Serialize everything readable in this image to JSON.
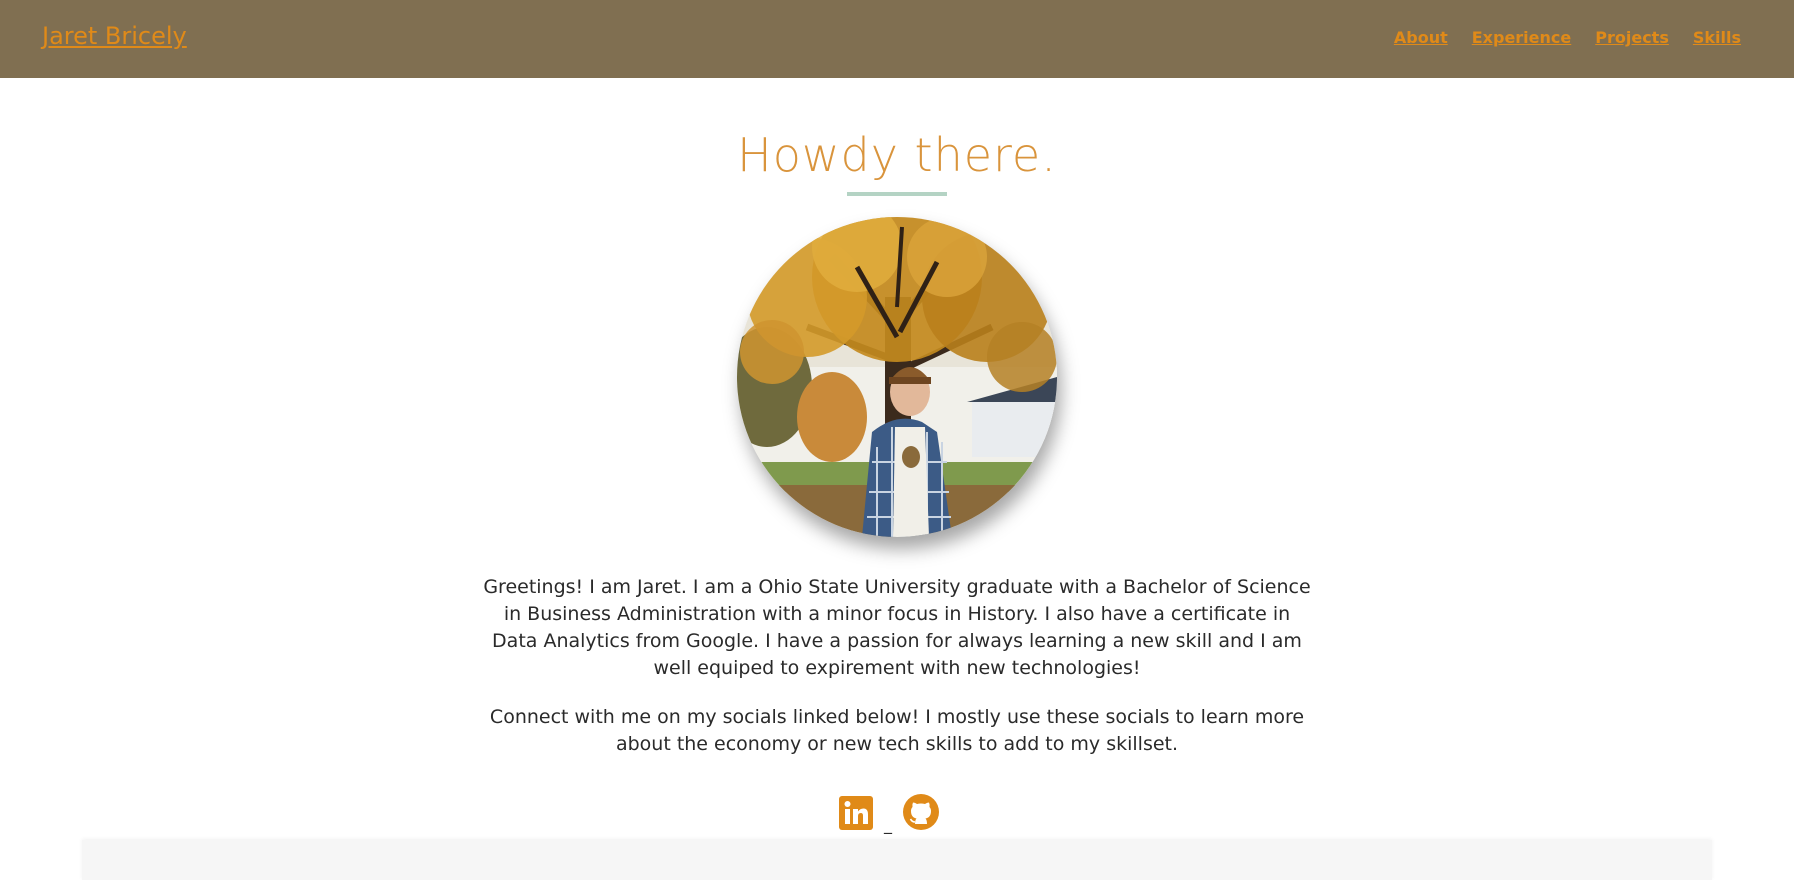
{
  "navbar": {
    "brand": "Jaret Bricely",
    "links": [
      {
        "label": "About"
      },
      {
        "label": "Experience"
      },
      {
        "label": "Projects"
      },
      {
        "label": "Skills"
      }
    ]
  },
  "hero": {
    "heading": "Howdy there.",
    "intro": "Greetings! I am Jaret. I am a Ohio State University graduate with a Bachelor of Science in Business Administration with a minor focus in History. I also have a certificate in Data Analytics from Google. I have a passion for always learning a new skill and I am well equiped to expirement with new technologies!",
    "connect": "Connect with me on my socials linked below! I mostly use these socials to learn more about the economy or new tech skills to add to my skillset."
  },
  "socials": {
    "separator": "_",
    "items": [
      {
        "icon": "linkedin-icon"
      },
      {
        "icon": "github-icon"
      }
    ]
  },
  "colors": {
    "navbar_bg": "#806f51",
    "accent": "#e08a18",
    "heading": "#d9943c",
    "rule": "#b4d3c4"
  }
}
